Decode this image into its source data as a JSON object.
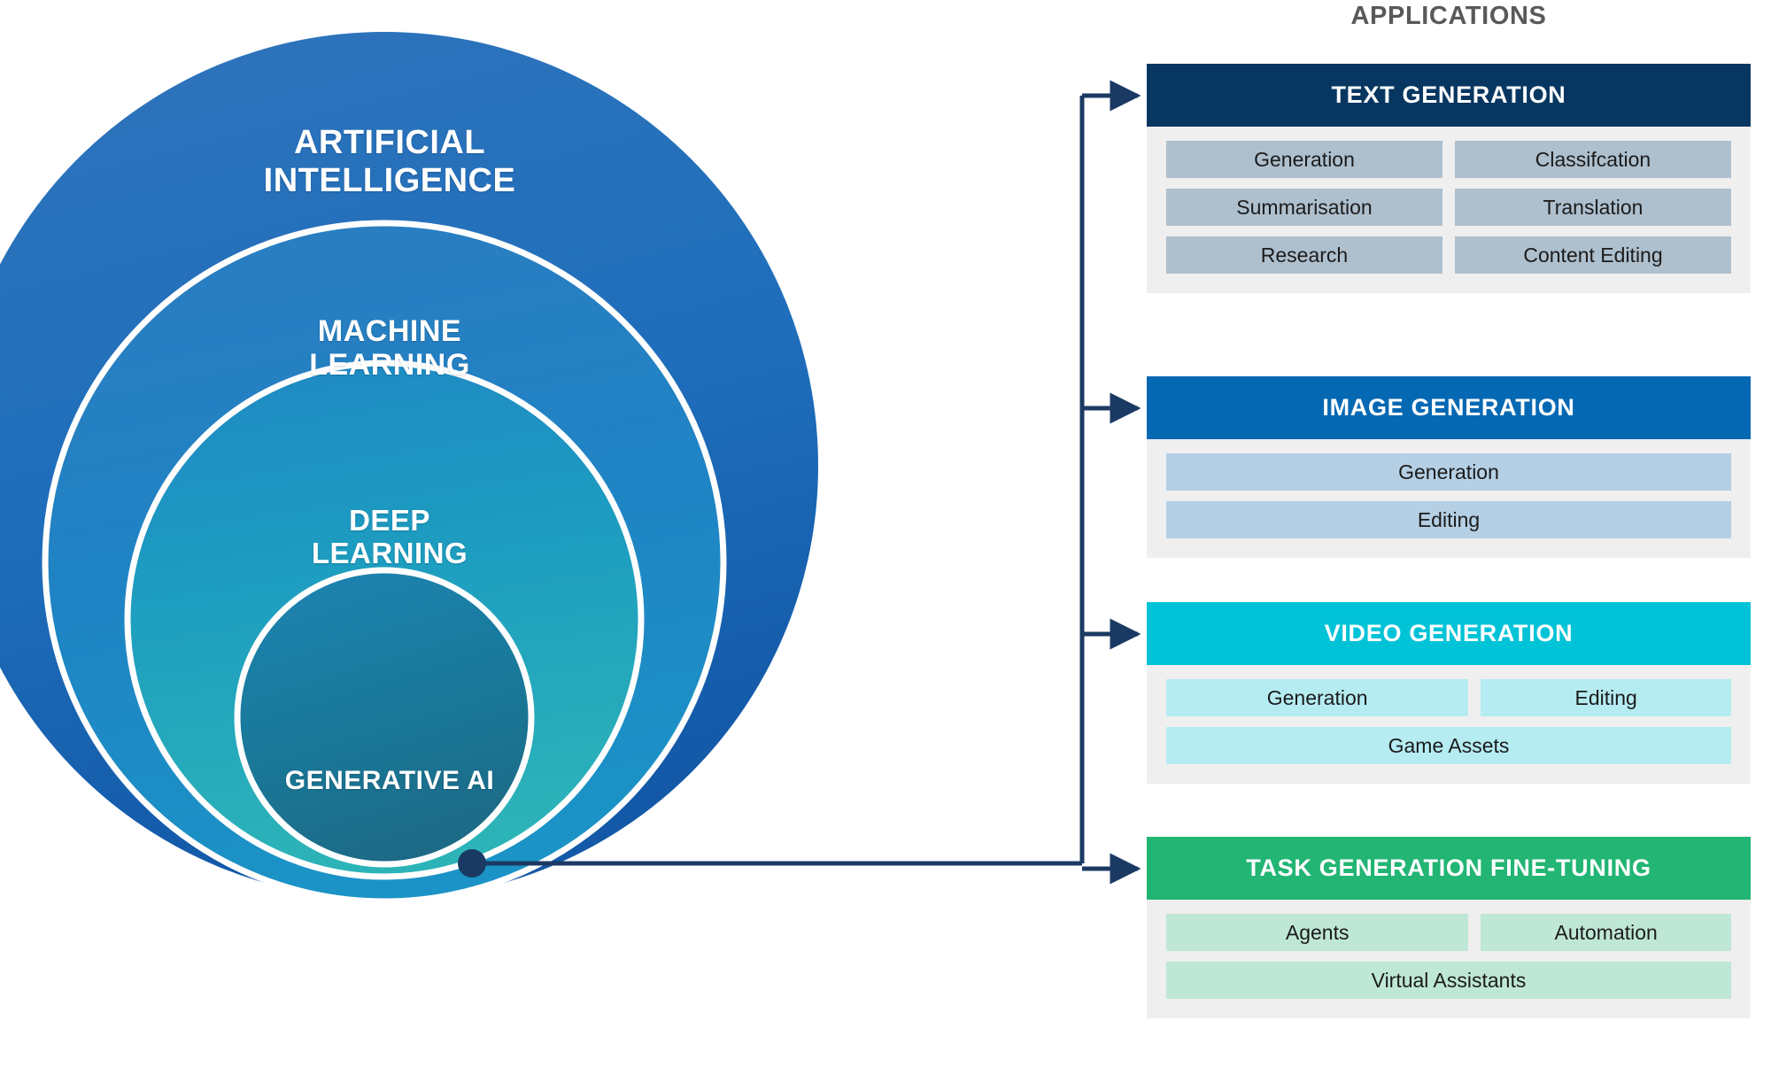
{
  "diagram": {
    "title": "APPLICATIONS",
    "title_color": "#58595b"
  },
  "venn": {
    "layers": [
      {
        "id": "artificial-intelligence",
        "label": "ARTIFICIAL\nINTELLIGENCE",
        "color_top": "#2a6fb8",
        "color_bottom": "#1565b0"
      },
      {
        "id": "machine-learning",
        "label": "MACHINE\nLEARNING",
        "color_top": "#2b7ec0",
        "color_bottom": "#1a86c4"
      },
      {
        "id": "deep-learning",
        "label": "DEEP\nLEARNING",
        "color_top": "#1f87c3",
        "color_bottom": "#2aa6b8"
      },
      {
        "id": "generative-ai",
        "label": "GENERATIVE AI",
        "color_top": "#1b7fae",
        "color_bottom": "#1d6f8e"
      }
    ],
    "connector_dot_color": "#1b3a63",
    "connector_line_color": "#1b3a63"
  },
  "panels": [
    {
      "id": "text-generation",
      "header": "TEXT GENERATION",
      "header_color": "#073761",
      "chip_color": "#aebfcd",
      "body_color": "#efefef",
      "rows": [
        [
          "Generation",
          "Classifcation"
        ],
        [
          "Summarisation",
          "Translation"
        ],
        [
          "Research",
          "Content Editing"
        ]
      ]
    },
    {
      "id": "image-generation",
      "header": "IMAGE GENERATION",
      "header_color": "#0568b3",
      "chip_color": "#b5cfe4",
      "body_color": "#efefef",
      "rows": [
        [
          "Generation"
        ],
        [
          "Editing"
        ]
      ]
    },
    {
      "id": "video-generation",
      "header": "VIDEO GENERATION",
      "header_color": "#00c3d8",
      "chip_color": "#b5ecf2",
      "body_color": "#efefef",
      "rows": [
        [
          "Generation",
          "Editing"
        ],
        [
          "Game Assets"
        ]
      ]
    },
    {
      "id": "task-generation-fine-tuning",
      "header": "TASK GENERATION FINE-TUNING",
      "header_color": "#22b573",
      "chip_color": "#bfe7d6",
      "body_color": "#efefef",
      "rows": [
        [
          "Agents",
          "Automation"
        ],
        [
          "Virtual Assistants"
        ]
      ]
    }
  ]
}
